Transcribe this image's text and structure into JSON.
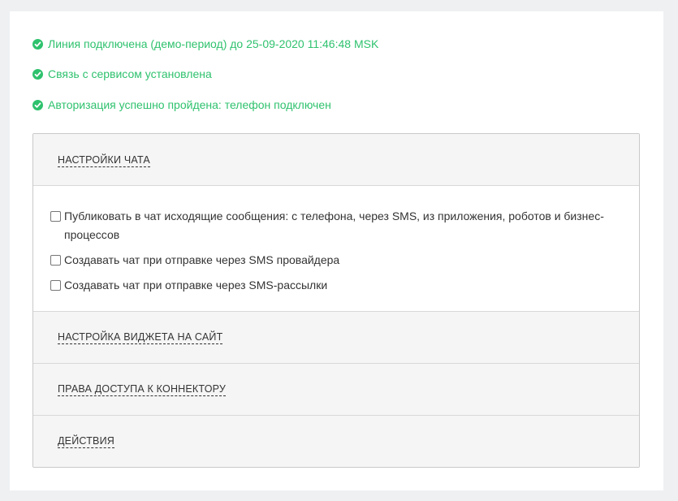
{
  "colors": {
    "success": "#2fc26e",
    "arrow": "#b0161b",
    "panel_header_bg": "#f5f5f5",
    "page_bg": "#eef0f2"
  },
  "status": [
    {
      "icon": "check-circle-icon",
      "text": "Линия подключена (демо-период) до 25-09-2020 11:46:48 MSK"
    },
    {
      "icon": "check-circle-icon",
      "text": "Связь с сервисом установлена"
    },
    {
      "icon": "check-circle-icon",
      "text": "Авторизация успешно пройдена: телефон подключен"
    }
  ],
  "sections": {
    "chat_settings": {
      "title": "НАСТРОЙКИ ЧАТА",
      "options": [
        {
          "label": "Публиковать в чат исходящие сообщения: с телефона, через SMS, из приложения, роботов и бизнес-процессов",
          "checked": false
        },
        {
          "label": "Создавать чат при отправке через SMS провайдера",
          "checked": false
        },
        {
          "label": "Создавать чат при отправке через SMS-рассылки",
          "checked": false
        }
      ]
    },
    "widget_settings": {
      "title": "НАСТРОЙКА ВИДЖЕТА НА САЙТ"
    },
    "access_rights": {
      "title": "ПРАВА ДОСТУПА К КОННЕКТОРУ"
    },
    "actions": {
      "title": "ДЕЙСТВИЯ"
    }
  }
}
